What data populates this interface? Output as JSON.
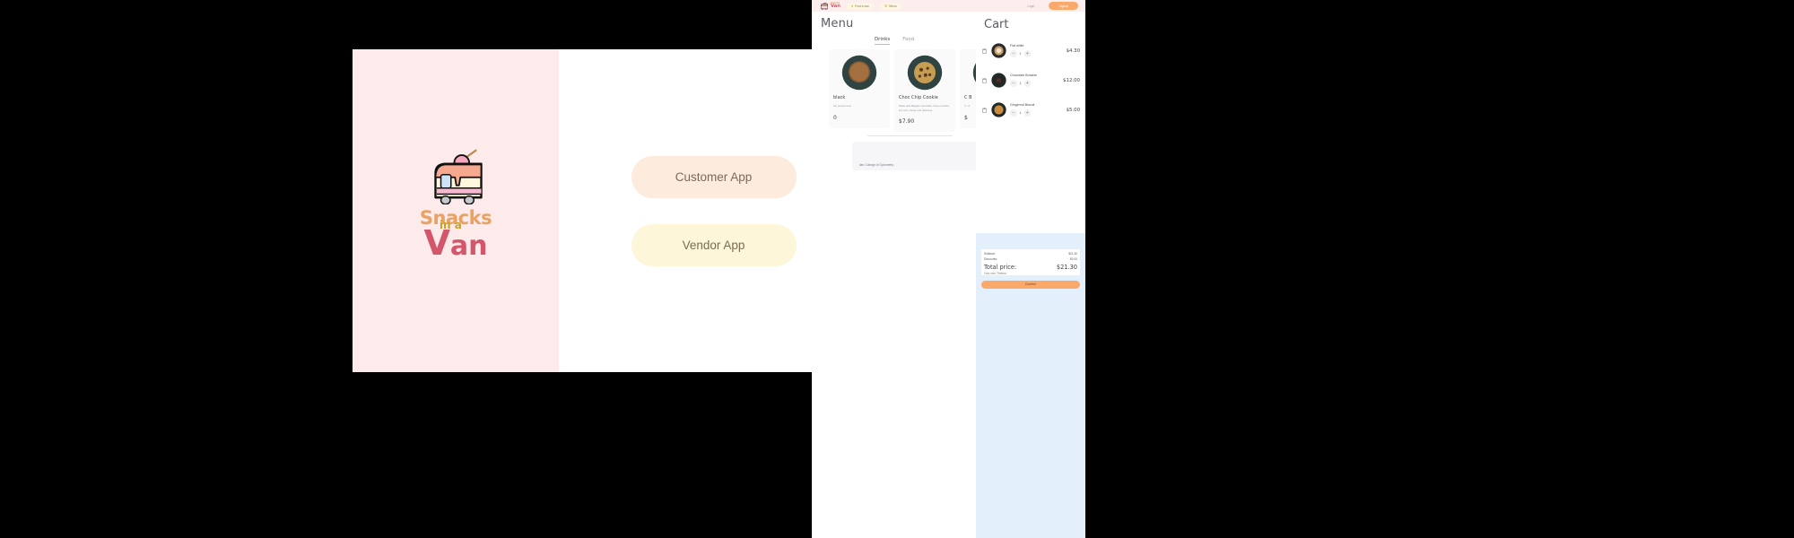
{
  "splash": {
    "logo": {
      "snacks": "Snacks",
      "in_a": "in a",
      "v": "V",
      "an": "an"
    },
    "customer_button": "Customer App",
    "vendor_button": "Vendor App"
  },
  "app": {
    "navbar": {
      "brand_snacks": "Snacks",
      "brand_in_a": "in a",
      "brand_van": "Van",
      "find_a_van": "Find a van",
      "menu": "Menu",
      "login": "Login",
      "signup": "Signup"
    },
    "menu": {
      "title": "Menu",
      "tabs": [
        {
          "label": "Drinks",
          "active": true
        },
        {
          "label": "Food",
          "active": false
        }
      ],
      "cards": [
        {
          "name": "black",
          "desc": "hot poured over",
          "price": "0",
          "clipped": true
        },
        {
          "name": "Choc Chip Cookie",
          "desc": "Made with Belgian chocolate, these cookies are soft, chewy and delicious.",
          "price": "$7.90",
          "clipped": false
        },
        {
          "name": "C B",
          "desc": "C i d",
          "price": "$",
          "clipped": true
        }
      ],
      "van_location": "lian College of Optometry",
      "edit_icon": "pencil-icon"
    }
  },
  "cart": {
    "title": "Cart",
    "items": [
      {
        "name": "Flat white",
        "qty": "1",
        "price": "$4.30"
      },
      {
        "name": "Chocolate Brownie",
        "qty": "1",
        "price": "$12.00"
      },
      {
        "name": "Gingernut Biscuit",
        "qty": "1",
        "price": "$5.00"
      }
    ],
    "subtotal_label": "Subtotal:",
    "subtotal_value": "$21.30",
    "discounts_label": "Discounts:",
    "discounts_value": "$0.00",
    "total_label": "Total price:",
    "total_value": "$21.30",
    "van_label": "Your van: Thelma",
    "confirm_label": "Confirm"
  },
  "colors": {
    "accent_orange": "#fba96a",
    "brand_red": "#d4566a",
    "brand_tan": "#e8a264",
    "brand_gold": "#c9a227",
    "splash_pink": "#fdeaea",
    "cart_blue": "#e3f0fb"
  }
}
